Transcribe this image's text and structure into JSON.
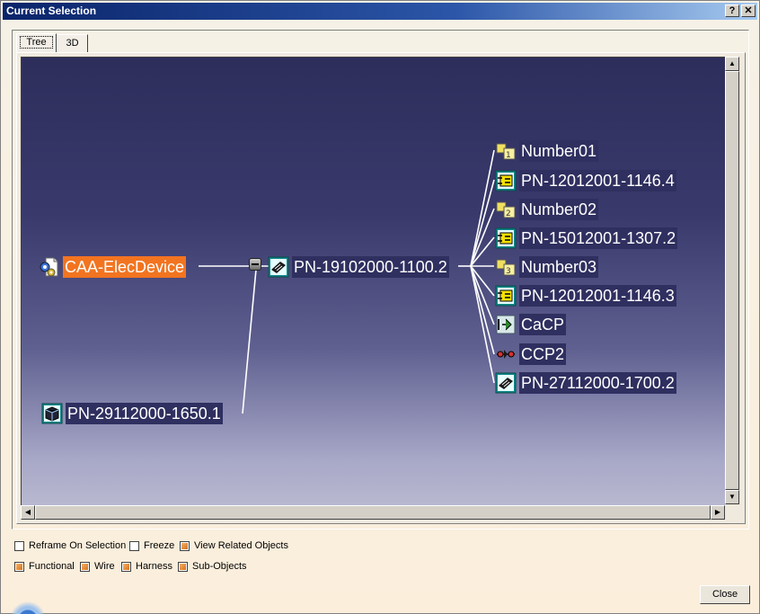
{
  "window": {
    "title": "Current Selection",
    "help_label": "?",
    "close_label": "✕"
  },
  "tabs": [
    {
      "label": "Tree",
      "active": true
    },
    {
      "label": "3D",
      "active": false
    }
  ],
  "tree": {
    "root": {
      "label": "CAA-ElecDevice",
      "icon": "product-gear-icon",
      "selected": true
    },
    "device": {
      "label": "PN-19102000-1100.2",
      "icon": "device-icon"
    },
    "sibling": {
      "label": "PN-29112000-1650.1",
      "icon": "device-box-icon"
    },
    "children": [
      {
        "label": "Number01",
        "icon": "number-icon"
      },
      {
        "label": "PN-12012001-1146.4",
        "icon": "connector-icon"
      },
      {
        "label": "Number02",
        "icon": "number-icon"
      },
      {
        "label": "PN-15012001-1307.2",
        "icon": "connector-icon"
      },
      {
        "label": "Number03",
        "icon": "number-icon"
      },
      {
        "label": "PN-12012001-1146.3",
        "icon": "connector-icon"
      },
      {
        "label": "CaCP",
        "icon": "cavity-connection-point-icon"
      },
      {
        "label": "CCP2",
        "icon": "connector-connection-point-icon"
      },
      {
        "label": "PN-27112000-1700.2",
        "icon": "device-icon"
      }
    ]
  },
  "options": {
    "row1": [
      {
        "label": "Reframe On Selection",
        "checked": false
      },
      {
        "label": "Freeze",
        "checked": false
      },
      {
        "label": "View Related Objects",
        "checked": true
      }
    ],
    "row2": [
      {
        "label": "Functional",
        "checked": true
      },
      {
        "label": "Wire",
        "checked": true
      },
      {
        "label": "Harness",
        "checked": true
      },
      {
        "label": "Sub-Objects",
        "checked": true
      }
    ]
  },
  "buttons": {
    "close": "Close"
  },
  "colors": {
    "selection": "#f27420",
    "background_top": "#2e2e5c",
    "background_bottom": "#b8b8d0"
  }
}
